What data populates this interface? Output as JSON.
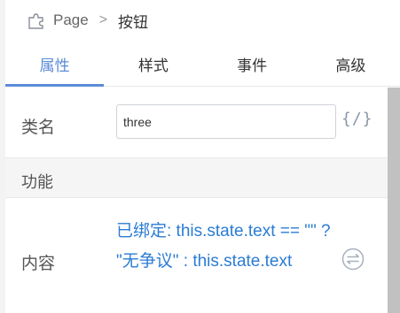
{
  "breadcrumb": {
    "root": "Page",
    "separator": ">",
    "current": "按钮"
  },
  "tabs": [
    {
      "label": "属性",
      "active": true
    },
    {
      "label": "样式",
      "active": false
    },
    {
      "label": "事件",
      "active": false
    },
    {
      "label": "高级",
      "active": false
    }
  ],
  "class_field": {
    "label": "类名",
    "value": "three",
    "code_icon_text": "{/}"
  },
  "section": {
    "title": "功能"
  },
  "content_field": {
    "label": "内容",
    "binding_text": "已绑定: this.state.text == \"\" ? \"无争议\" : this.state.text"
  },
  "colors": {
    "accent": "#5b8bd8",
    "binding": "#2b7cd3",
    "icon": "#8a96a8"
  },
  "icons": {
    "breadcrumb": "puzzle-icon",
    "code": "code-icon",
    "bind": "unbind-icon"
  }
}
